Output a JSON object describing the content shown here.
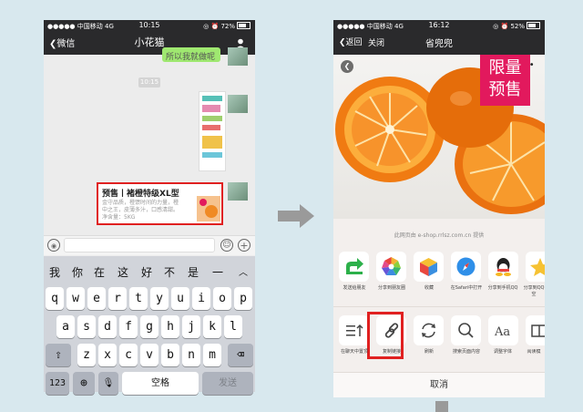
{
  "left": {
    "status": {
      "carrier": "中国移动",
      "network": "4G",
      "time": "10:15",
      "battery": "72%"
    },
    "nav": {
      "back": "微信",
      "title": "小花猫"
    },
    "partial_bubble": "所以我就做呢",
    "time_pill": "10:15",
    "product_card": {
      "title": "预售丨褚橙特级XL型",
      "desc": [
        "金守品质，橙馈时间的力量，橙",
        "中之王，皮薄多汁，口感清甜。",
        "净含量：5KG"
      ]
    },
    "suggestions": [
      "我",
      "你",
      "在",
      "这",
      "好",
      "不",
      "是",
      "一"
    ],
    "keyboard": {
      "row1": [
        "q",
        "w",
        "e",
        "r",
        "t",
        "y",
        "u",
        "i",
        "o",
        "p"
      ],
      "row2": [
        "a",
        "s",
        "d",
        "f",
        "g",
        "h",
        "j",
        "k",
        "l"
      ],
      "row3": [
        "z",
        "x",
        "c",
        "v",
        "b",
        "n",
        "m"
      ],
      "num": "123",
      "space": "空格",
      "send": "发送"
    }
  },
  "right": {
    "status": {
      "carrier": "中国移动",
      "network": "4G",
      "time": "16:12",
      "battery": "52%"
    },
    "nav": {
      "back": "返回",
      "close": "关闭",
      "title": "省兜兜"
    },
    "badge": [
      "限量",
      "预售"
    ],
    "source": "此网页由 e-shop.rrlsz.com.cn 提供",
    "share_row": [
      {
        "label": "发送给朋友",
        "icon": "share-arrow-icon"
      },
      {
        "label": "分享到朋友圈",
        "icon": "moments-icon"
      },
      {
        "label": "收藏",
        "icon": "favorite-cube-icon"
      },
      {
        "label": "在Safari中打开",
        "icon": "safari-icon"
      },
      {
        "label": "分享到手机QQ",
        "icon": "qq-icon"
      },
      {
        "label": "分享到QQ空",
        "icon": "qzone-icon"
      }
    ],
    "action_row": [
      {
        "label": "在聊天中置顶",
        "icon": "pin-top-icon"
      },
      {
        "label": "复制链接",
        "icon": "link-icon"
      },
      {
        "label": "刷新",
        "icon": "refresh-icon"
      },
      {
        "label": "搜索页面内容",
        "icon": "search-icon"
      },
      {
        "label": "调整字体",
        "icon": "font-icon"
      },
      {
        "label": "阅读模",
        "icon": "read-mode-icon"
      }
    ],
    "cancel": "取消"
  },
  "colors": {
    "highlight": "#e02020",
    "wechat_green": "#9fe870",
    "badge": "#e2195d",
    "arrow": "#9a9a9a"
  }
}
